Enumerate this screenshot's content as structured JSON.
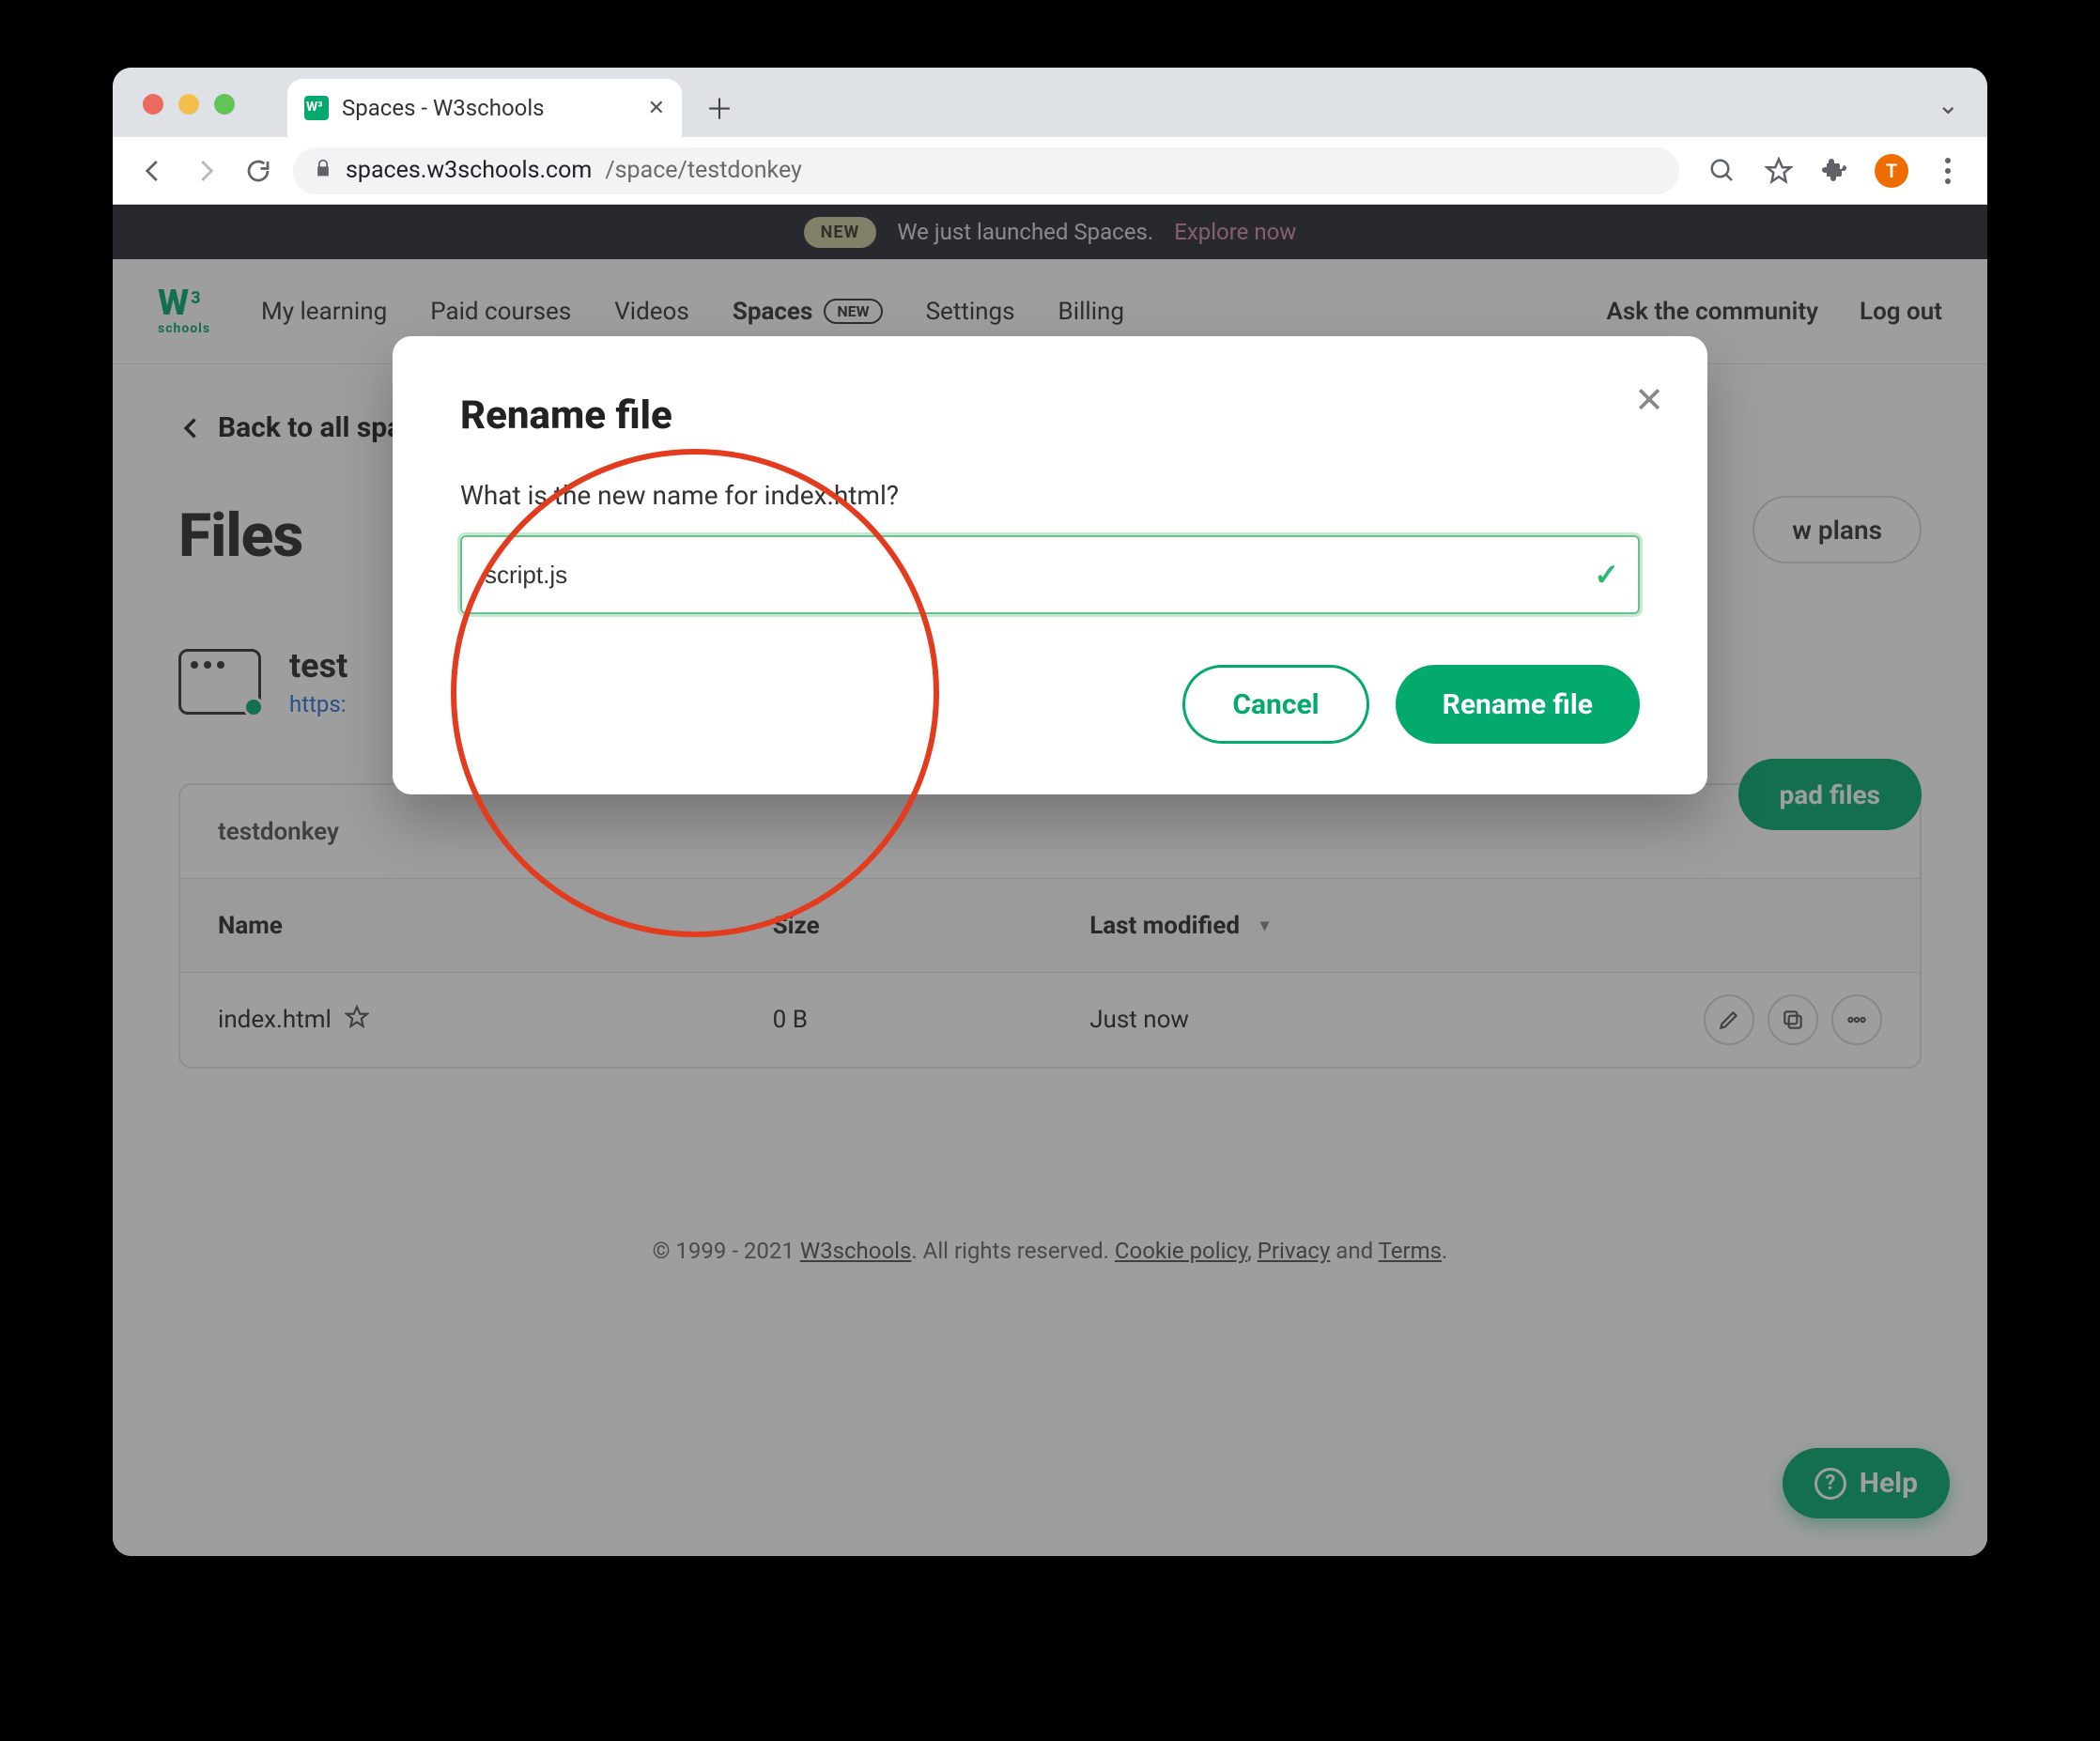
{
  "browser": {
    "tab_title": "Spaces - W3schools",
    "url_host": "spaces.w3schools.com",
    "url_path": "/space/testdonkey",
    "avatar_letter": "T"
  },
  "announce": {
    "badge": "NEW",
    "text": "We just launched Spaces.",
    "link": "Explore now"
  },
  "nav": {
    "items": [
      "My learning",
      "Paid courses",
      "Videos"
    ],
    "spaces": "Spaces",
    "spaces_badge": "NEW",
    "more": [
      "Settings",
      "Billing"
    ],
    "right": [
      "Ask the community",
      "Log out"
    ]
  },
  "back_link": "Back to all spaces",
  "page_title": "Files",
  "plans_button": "w plans",
  "space": {
    "name": "test",
    "url": "https:"
  },
  "upload_button": "pad files",
  "table": {
    "breadcrumb": "testdonkey",
    "columns": [
      "Name",
      "Size",
      "Last modified"
    ],
    "rows": [
      {
        "name": "index.html",
        "size": "0 B",
        "modified": "Just now"
      }
    ]
  },
  "footer": {
    "copyright": "© 1999 - 2021 ",
    "brand": "W3schools",
    "rights": ". All rights reserved. ",
    "links": [
      "Cookie policy",
      "Privacy",
      "Terms"
    ],
    "sep1": ", ",
    "sep2": " and ",
    "end": "."
  },
  "help_label": "Help",
  "modal": {
    "title": "Rename file",
    "prompt": "What is the new name for index.html?",
    "input_value": "script.js",
    "cancel": "Cancel",
    "confirm": "Rename file"
  }
}
